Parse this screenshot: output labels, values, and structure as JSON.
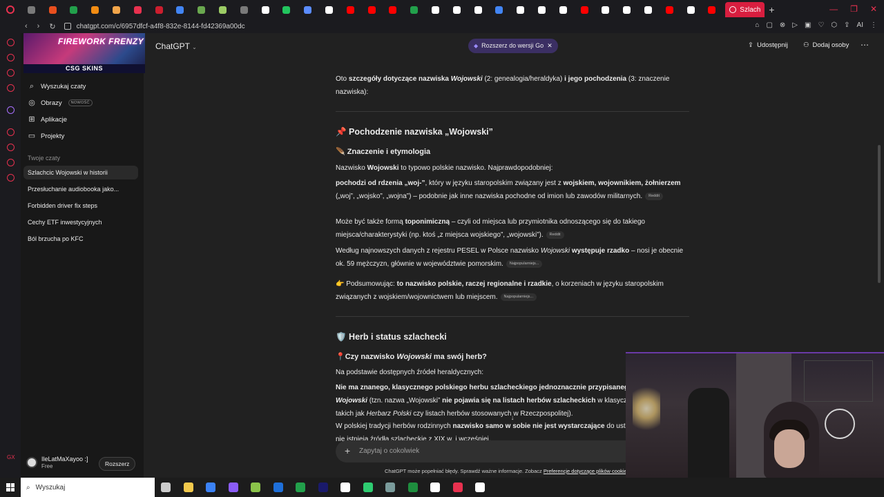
{
  "browser": {
    "url": "chatgpt.com/c/6957dfcf-a4f8-832e-8144-fd42369a00dc",
    "active_tab_label": "Szlach",
    "tab_favicon_colors": [
      "#7a7a7a",
      "#e94f1e",
      "#22a04b",
      "#f28c13",
      "#f2a54a",
      "#e8314f",
      "#cc1e2e",
      "#4285f4",
      "#6aa84f",
      "#9ccc65",
      "#7a7a7a",
      "#ffffff",
      "#22c55e",
      "#5b8cff",
      "#ffffff",
      "#ff0000",
      "#ff0000",
      "#ff0000",
      "#22a04b",
      "#ffffff",
      "#ffffff",
      "#ffffff",
      "#4285f4",
      "#ffffff",
      "#ffffff",
      "#ffffff",
      "#ff0000",
      "#ffffff",
      "#ffffff",
      "#ffffff",
      "#ff0000",
      "#ffffff",
      "#ff0000"
    ]
  },
  "sidebar": {
    "banner_title": "FIREWORK FRENZY",
    "banner_sub": "CSG SKINS",
    "items": [
      {
        "label": "Wyszukaj czaty",
        "icon": "search-icon"
      },
      {
        "label": "Obrazy",
        "icon": "image-icon",
        "badge": "NOWOŚĆ"
      },
      {
        "label": "Aplikacje",
        "icon": "apps-icon"
      },
      {
        "label": "Projekty",
        "icon": "folder-icon"
      }
    ],
    "section_label": "Twoje czaty",
    "chats": [
      "Szlachcic Wojowski w historii",
      "Przesłuchanie audiobooka jako...",
      "Forbidden driver fix steps",
      "Cechy ETF inwestycyjnych",
      "Ból brzucha po KFC"
    ],
    "user_name": "IleLatMaXayoo :]",
    "user_plan": "Free",
    "upgrade_label": "Rozszerz"
  },
  "topbar": {
    "model_label": "ChatGPT",
    "go_label": "Rozszerz do wersji Go",
    "share_label": "Udostępnij",
    "add_label": "Dodaj osoby"
  },
  "content": {
    "intro_1": "Oto ",
    "intro_2": "szczegóły dotyczące nazwiska ",
    "intro_3": "Wojowski",
    "intro_4": " (2: genealogia/heraldyka) ",
    "intro_5": "i jego pochodzenia",
    "intro_6": " (3: znaczenie nazwiska):",
    "h_origin": "📌 Pochodzenie nazwiska „Wojowski”",
    "h_meaning": "🪶 Znaczenie i etymologia",
    "p_name_1": "Nazwisko ",
    "p_name_2": "Wojowski",
    "p_name_3": " to typowo polskie nazwisko. Najprawdopodobniej:",
    "b1_1": "pochodzi od rdzenia „woj-”",
    "b1_2": ", który w języku staropolskim związany jest z ",
    "b1_3": "wojskiem, wojownikiem, żołnierzem",
    "b1_4": " („woj”, „wojsko”, „wojna”) – podobnie jak inne nazwiska pochodne od imion lub zawodów militarnych.",
    "b1_src": "Reddit",
    "b2_1": "Może być także formą ",
    "b2_2": "toponimiczną",
    "b2_3": " – czyli od miejsca lub przymiotnika odnoszącego się do takiego miejsca/charakterystyki (np. ktoś „z miejsca wojskiego”, „wojowski”).",
    "b2_src": "Reddit",
    "p_pesel_1": "Według najnowszych danych z rejestru PESEL w Polsce nazwisko ",
    "p_pesel_2": "Wojowski",
    "p_pesel_3": " występuje rzadko",
    "p_pesel_4": " – nosi je obecnie ok. 59 mężczyzn, głównie w województwie pomorskim.",
    "p_pesel_src": "Najpopularniejs...",
    "p_sum_1": "👉 Podsumowując: ",
    "p_sum_2": "to nazwisko polskie, raczej regionalne i rzadkie",
    "p_sum_3": ", o korzeniach w języku staropolskim związanych z wojskiem/wojownictwem lub miejscem.",
    "p_sum_src": "Najpopularniejs...",
    "h_herb": "🛡️ Herb i status szlachecki",
    "h_question_1": "📍Czy nazwisko ",
    "h_question_2": "Wojowski",
    "h_question_3": " ma swój herb?",
    "p_basis": "Na podstawie dostępnych źródeł heraldycznych:",
    "b3_1": "Nie ma znanego, klasycznego polskiego herbu szlacheckiego jednoznacznie przypisanego do nazwiska ",
    "b3_2": "Wojowski",
    "b3_3": " (tzn. nazwa „Wojowski” ",
    "b3_4": "nie pojawia się na listach herbów szlacheckich",
    "b3_5": " w klasycznych herbarzach takich jak ",
    "b3_6": "Herbarz Polski",
    "b3_7": " czy listach herbów stosowanych w Rzeczpospolitej).",
    "b4_1": "W polskiej tradycji herbów rodzinnych ",
    "b4_2": "nazwisko samo w sobie nie jest wystarczające",
    "b4_3": " do ustalenia herbu, jeżeli nie istnieją źródła szlacheckie z XIX w. i wcześniej."
  },
  "composer": {
    "placeholder": "Zapytaj o cokolwiek"
  },
  "disclaimer": {
    "text": "ChatGPT może popełniać błędy. Sprawdź ważne informacje. Zobacz ",
    "link": "Preferencje dotyczące plików cookie"
  },
  "taskbar": {
    "search_label": "Wyszukaj",
    "icon_colors": [
      "#cccccc",
      "#f2c94c",
      "#3b82f6",
      "#8b5cf6",
      "#8bc34a",
      "#1e6fd9",
      "#22a04b",
      "#1a1a6b",
      "#ffffff",
      "#2ecc71",
      "#7a9b9b",
      "#1e8e3e",
      "#ffffff",
      "#e8314f",
      "#ffffff"
    ]
  }
}
